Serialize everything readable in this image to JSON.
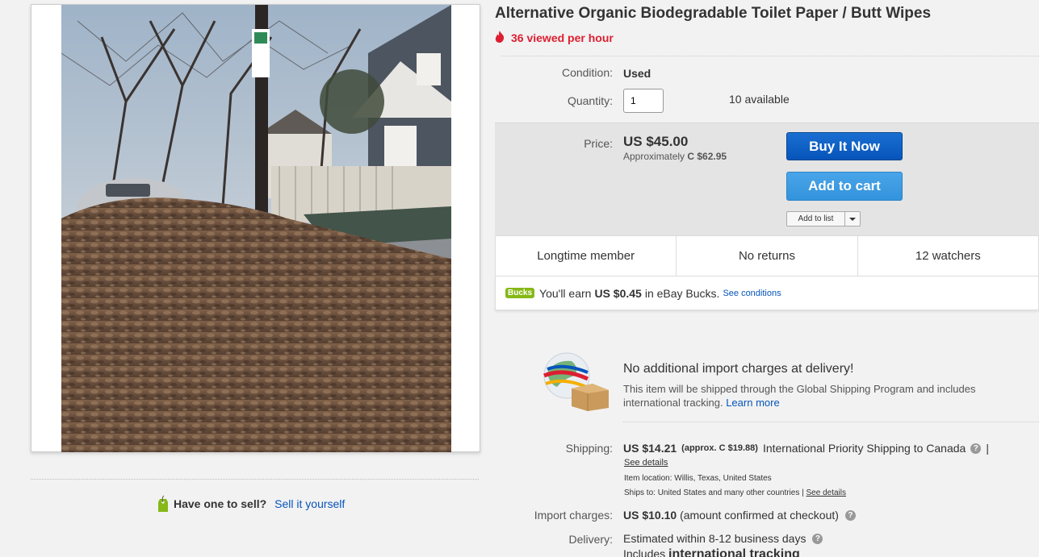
{
  "listing": {
    "title": "Alternative Organic Biodegradable Toilet Paper / Butt Wipes",
    "viewed": "36 viewed per hour"
  },
  "condition": {
    "label": "Condition:",
    "value": "Used"
  },
  "quantity": {
    "label": "Quantity:",
    "value": "1",
    "available": "10 available"
  },
  "price": {
    "label": "Price:",
    "value": "US $45.00",
    "approx_prefix": "Approximately",
    "approx_value": "C $62.95"
  },
  "buttons": {
    "buy_now": "Buy It Now",
    "add_to_cart": "Add to cart",
    "add_to_list": "Add to list"
  },
  "stats": [
    "Longtime member",
    "No returns",
    "12 watchers"
  ],
  "bucks": {
    "badge": "Bucks",
    "prefix": "You'll earn",
    "amount": "US $0.45",
    "suffix": "in eBay Bucks.",
    "link": "See conditions"
  },
  "gsp": {
    "title": "No additional import charges at delivery!",
    "desc": "This item will be shipped through the Global Shipping Program and includes international tracking.",
    "link": "Learn more"
  },
  "shipping": {
    "label": "Shipping:",
    "cost": "US $14.21",
    "approx": "(approx. C $19.88)",
    "service": "International Priority Shipping to Canada",
    "pipe": "|",
    "see_details": "See details",
    "item_location": "Item location:  Willis, Texas, United States",
    "ships_to_prefix": "Ships to:  United States and many other countries |",
    "ships_to_link": "See details"
  },
  "import": {
    "label": "Import charges:",
    "value": "US $10.10",
    "note": "(amount confirmed at checkout)"
  },
  "delivery": {
    "label": "Delivery:",
    "value": "Estimated within 8-12 business days",
    "includes": "Includes",
    "includes_bold": "international tracking"
  },
  "sell": {
    "label": "Have one to sell?",
    "link": "Sell it yourself"
  },
  "icons": {
    "fire": "fire-icon",
    "help": "help-icon",
    "tag": "tag-icon",
    "globe": "globe-box-icon"
  },
  "colors": {
    "accent_blue": "#0654ba",
    "hot_red": "#dd1e31",
    "bucks_green": "#86b817"
  }
}
